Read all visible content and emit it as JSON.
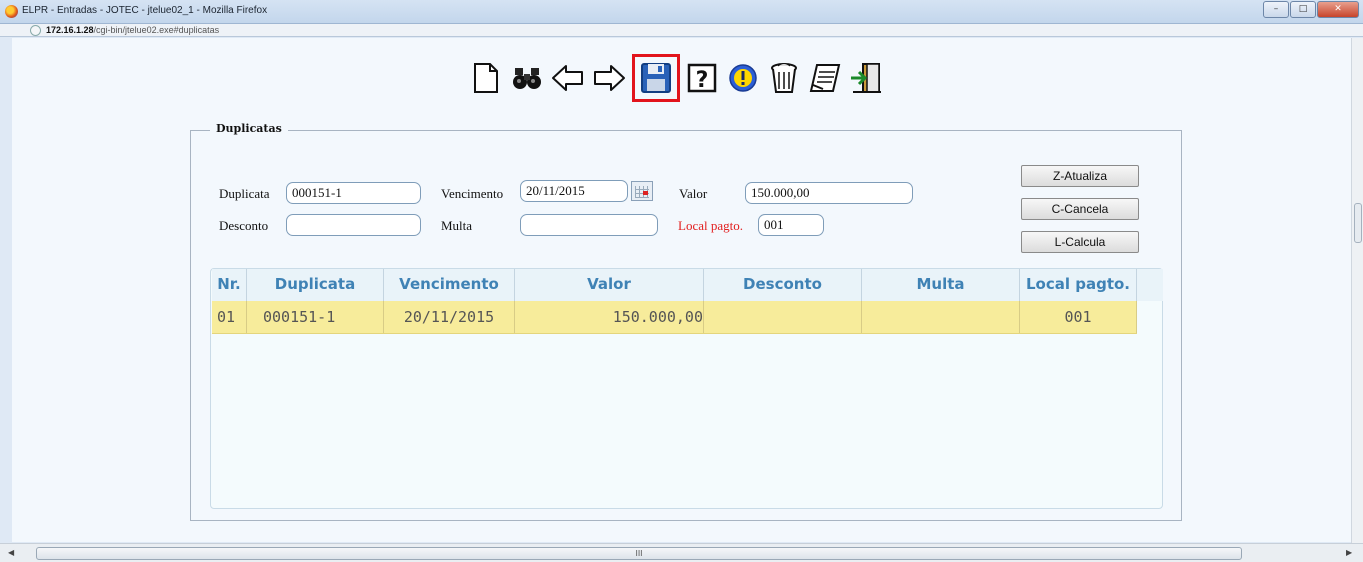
{
  "window": {
    "title": "ELPR - Entradas - JOTEC - jtelue02_1 - Mozilla Firefox",
    "url_host": "172.16.1.28",
    "url_path": "/cgi-bin/jtelue02.exe#duplicatas",
    "controls": [
      "minimize",
      "maximize",
      "close"
    ]
  },
  "toolbar": {
    "icons": [
      "new-document-icon",
      "binoculars-search-icon",
      "arrow-left-icon",
      "arrow-right-icon",
      "floppy-save-icon",
      "help-icon",
      "info-alert-icon",
      "trash-bin-icon",
      "notepad-icon",
      "exit-door-icon"
    ],
    "highlighted": "floppy-save-icon",
    "highlight_color": "#e2141c"
  },
  "form": {
    "legend": "Duplicatas",
    "duplicata_label": "Duplicata",
    "duplicata_value": "000151-1",
    "vencimento_label": "Vencimento",
    "vencimento_value": "20/11/2015",
    "valor_label": "Valor",
    "valor_value": "150.000,00",
    "desconto_label": "Desconto",
    "desconto_value": "",
    "multa_label": "Multa",
    "multa_value": "",
    "local_pagto_label": "Local pagto.",
    "local_pagto_value": "001",
    "local_pagto_color": "#e21f1f"
  },
  "buttons": {
    "atualiza": "Z-Atualiza",
    "cancela": "C-Cancela",
    "calcula": "L-Calcula"
  },
  "table": {
    "headers": [
      "Nr.",
      "Duplicata",
      "Vencimento",
      "Valor",
      "Desconto",
      "Multa",
      "Local pagto."
    ],
    "rows": [
      [
        "01",
        "000151-1",
        "20/11/2015",
        "150.000,00",
        "",
        "",
        "001"
      ]
    ],
    "header_color": "#3f82b5",
    "row_highlight": "#f7ec9b"
  },
  "scrollbar": {
    "thumb_label": "III"
  }
}
